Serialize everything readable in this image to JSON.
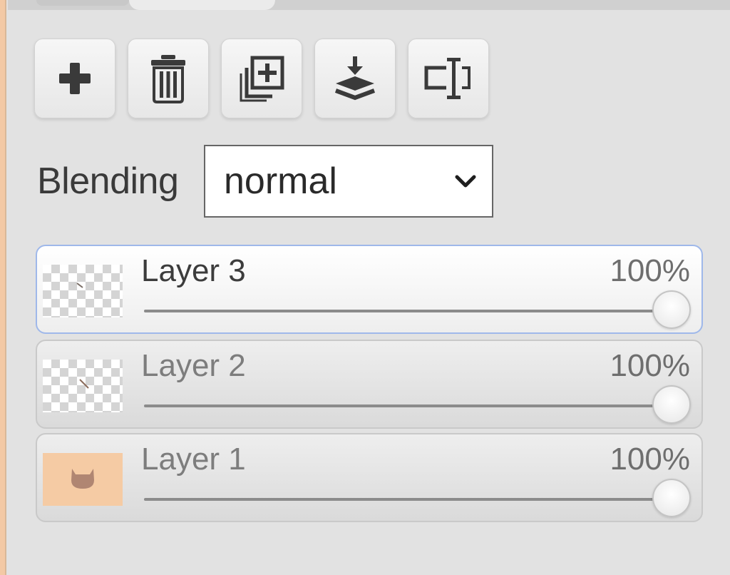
{
  "toolbar": {
    "buttons": [
      {
        "action": "add-layer",
        "icon": "plus-icon"
      },
      {
        "action": "delete-layer",
        "icon": "trash-icon"
      },
      {
        "action": "duplicate-layer",
        "icon": "duplicate-icon"
      },
      {
        "action": "merge-down",
        "icon": "merge-down-icon"
      },
      {
        "action": "rename-layer",
        "icon": "rename-icon"
      }
    ]
  },
  "blending": {
    "label": "Blending",
    "value": "normal"
  },
  "layers": [
    {
      "name": "Layer 3",
      "opacity_label": "100%",
      "opacity": 1.0,
      "active": true,
      "thumbnail": "transparent"
    },
    {
      "name": "Layer 2",
      "opacity_label": "100%",
      "opacity": 1.0,
      "active": false,
      "thumbnail": "transparent"
    },
    {
      "name": "Layer 1",
      "opacity_label": "100%",
      "opacity": 1.0,
      "active": false,
      "thumbnail": "peach-cat"
    }
  ],
  "colors": {
    "panel_bg": "#e2e2e2",
    "active_border": "#9fb8ea",
    "layer1_fill": "#f5cba4"
  }
}
